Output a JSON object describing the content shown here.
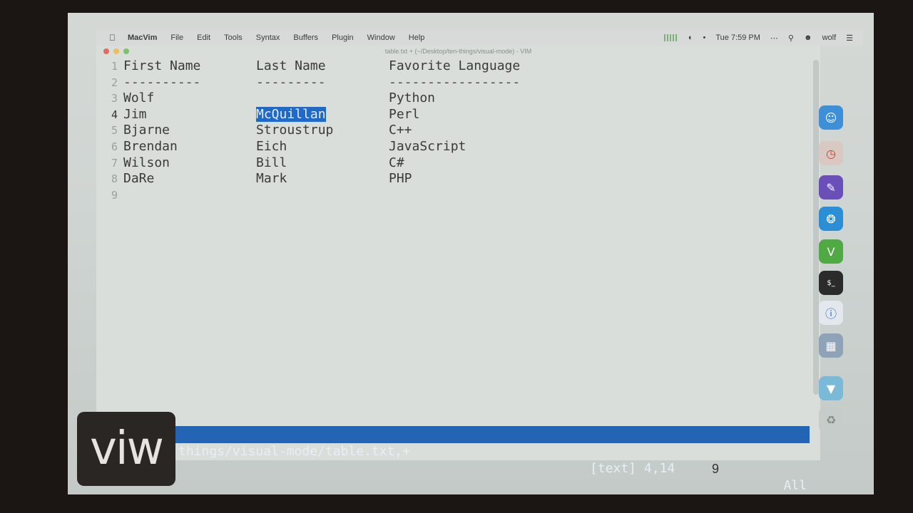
{
  "menubar": {
    "items": [
      "MacVim",
      "File",
      "Edit",
      "Tools",
      "Syntax",
      "Buffers",
      "Plugin",
      "Window",
      "Help"
    ],
    "clock": "Tue 7:59 PM",
    "user": "wolf"
  },
  "window": {
    "title": "table.txt + (~/Desktop/ten-things/visual-mode) - VIM"
  },
  "editor": {
    "lines": [
      {
        "num": "1",
        "c1": "First Name",
        "c2": "Last Name",
        "c3": "Favorite Language"
      },
      {
        "num": "2",
        "c1": "----------",
        "c2": "---------",
        "c3": "-----------------"
      },
      {
        "num": "3",
        "c1": "Wolf",
        "c2": "",
        "c3": "Python"
      },
      {
        "num": "4",
        "c1": "Jim",
        "c2": "McQuillan",
        "c3": "Perl"
      },
      {
        "num": "5",
        "c1": "Bjarne",
        "c2": "Stroustrup",
        "c3": "C++"
      },
      {
        "num": "6",
        "c1": "Brendan",
        "c2": "Eich",
        "c3": "JavaScript"
      },
      {
        "num": "7",
        "c1": "Wilson",
        "c2": "Bill",
        "c3": "C#"
      },
      {
        "num": "8",
        "c1": "DaRe",
        "c2": "Mark",
        "c3": "PHP"
      },
      {
        "num": "9",
        "c1": "",
        "c2": "",
        "c3": ""
      }
    ],
    "selected_text": "McQuillan"
  },
  "statusline": {
    "path": "things/visual-mode/table.txt,+",
    "filetype_pos": "[text] 4,14",
    "percent": "All"
  },
  "overlay": {
    "logo": "viw",
    "page_number": "9"
  },
  "colors": {
    "selection": "#1f69c9",
    "statusline": "#2364b5"
  }
}
